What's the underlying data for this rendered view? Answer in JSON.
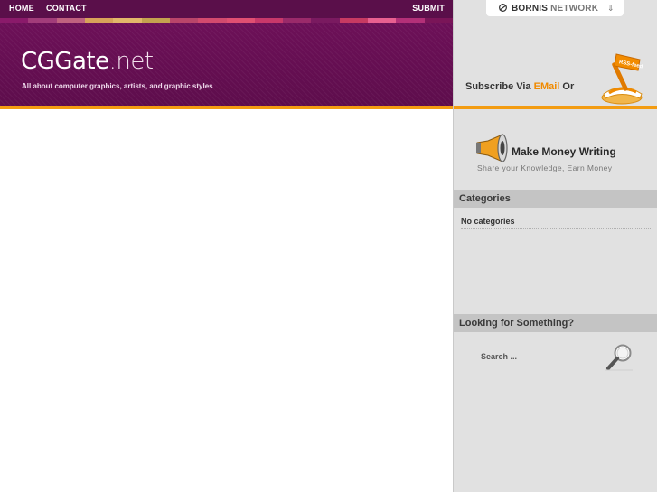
{
  "nav": {
    "home": "HOME",
    "contact": "CONTACT",
    "submit": "SUBMIT"
  },
  "stripe_colors": [
    "#8a1a6a",
    "#a23c7a",
    "#c0627f",
    "#d8a35a",
    "#e2b86a",
    "#c4a24f",
    "#b9456a",
    "#d24a6e",
    "#e04f72",
    "#c8386a",
    "#9a2a6a",
    "#7a1a60",
    "#c73a62",
    "#e86090",
    "#b33078",
    "#7a1558"
  ],
  "header": {
    "logo_main": "CGGate",
    "logo_suffix": ".net",
    "tagline": "All about computer graphics, artists, and graphic styles",
    "bg_color": "#6a0f55",
    "accent_color": "#f39c12"
  },
  "sidebar": {
    "network": {
      "brand": "BORNIS",
      "network": "NETWORK",
      "arrow": "⇓",
      "icon": "globe-icon"
    },
    "subscribe": {
      "prefix": "Subscribe Via ",
      "email": "EMail",
      "suffix": "  Or",
      "rss_label": "RSS-feed",
      "icon": "rss-feed-icon"
    },
    "money": {
      "title": "Make Money Writing",
      "subtitle": "Share your Knowledge, Earn Money",
      "icon": "megaphone-icon"
    },
    "categories": {
      "title": "Categories",
      "empty": "No categories"
    },
    "search": {
      "title": "Looking for Something?",
      "placeholder": "Search ...",
      "icon": "magnifier-icon"
    }
  }
}
